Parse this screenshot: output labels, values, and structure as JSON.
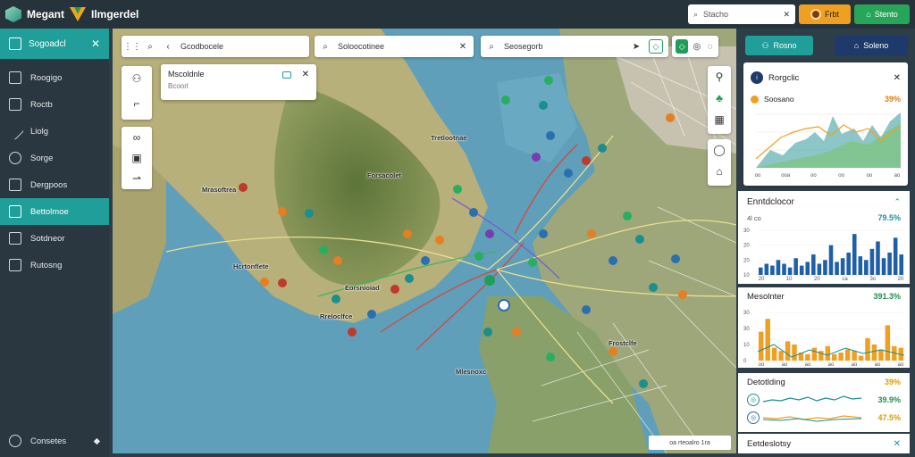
{
  "app": {
    "title": "Megant",
    "subtitle": "Ilmgerdel"
  },
  "topbar": {
    "search": {
      "value": "Stacho",
      "icon": "search-icon"
    },
    "profile_button": {
      "label": "Frbt"
    },
    "action_button": {
      "label": "Stento"
    }
  },
  "sidebar": {
    "header": "Sogoadcl",
    "items": [
      {
        "label": "Roogigo",
        "icon": "home-icon"
      },
      {
        "label": "Roctb",
        "icon": "folder-icon"
      },
      {
        "label": "Liolg",
        "icon": "edit-icon"
      },
      {
        "label": "Sorge",
        "icon": "clock-icon"
      },
      {
        "label": "Dergpoos",
        "icon": "document-icon"
      },
      {
        "label": "Bettolmoe",
        "icon": "chart-icon",
        "active": true
      },
      {
        "label": "Sotdneor",
        "icon": "inbox-icon"
      },
      {
        "label": "Rutosng",
        "icon": "layers-icon"
      }
    ],
    "footer": "Consetes"
  },
  "map": {
    "toolbars": [
      {
        "label": "Gcodbocele"
      },
      {
        "label": "Soloocotinee"
      },
      {
        "label": "Seosegorb"
      }
    ],
    "popup": {
      "title": "Mscoldnle",
      "subtitle": "Bcoorl"
    },
    "labels": [
      {
        "text": "Mrasoftrea"
      },
      {
        "text": "Hcrtonflete"
      },
      {
        "text": "Rreloclfce"
      },
      {
        "text": "Forsacolet"
      },
      {
        "text": "Tretlootnae"
      },
      {
        "text": "Eorsnioiad"
      },
      {
        "text": "Frostclfe"
      },
      {
        "text": "Mlesnoxc"
      }
    ],
    "footer_text": "oa rteoalro 1ra"
  },
  "right_panel": {
    "buttons": [
      {
        "label": "Rosno",
        "color": "#1f9e9a"
      },
      {
        "label": "Soleno",
        "color": "#1e3a6a"
      }
    ],
    "card": {
      "title": "Rorgclic",
      "metric_label": "Soosano",
      "metric_value": "39%",
      "x_ticks": [
        "oo",
        "ooa",
        "oo",
        "oo",
        "oo",
        "ao"
      ]
    },
    "section1": {
      "title": "Enntdclocor",
      "caption": "4l co",
      "value": "79.5%",
      "y_ticks": [
        "30",
        "20",
        "20",
        "10"
      ],
      "x_ticks": [
        "20",
        "10",
        "20",
        "ca",
        "3o",
        "20"
      ],
      "bars": [
        4,
        6,
        5,
        8,
        6,
        4,
        9,
        5,
        7,
        11,
        6,
        8,
        16,
        7,
        9,
        12,
        22,
        10,
        8,
        14,
        18,
        9,
        12,
        20,
        11
      ]
    },
    "section2": {
      "title": "Mesolnter",
      "value": "391.3%",
      "y_ticks": [
        "30",
        "30",
        "10",
        "0"
      ],
      "x_ticks": [
        "oo",
        "ao",
        "ao",
        "ao",
        "ao",
        "ao",
        "ao"
      ],
      "bars": [
        18,
        26,
        8,
        6,
        12,
        10,
        5,
        4,
        8,
        6,
        9,
        4,
        5,
        7,
        6,
        3,
        14,
        10,
        7,
        22,
        9,
        8
      ]
    },
    "section3": {
      "title": "Detotlding",
      "value": "39%",
      "rows": [
        {
          "value": "39.9%"
        },
        {
          "value": "47.5%"
        }
      ]
    },
    "section4": {
      "title": "Eetdeslotsy"
    }
  }
}
